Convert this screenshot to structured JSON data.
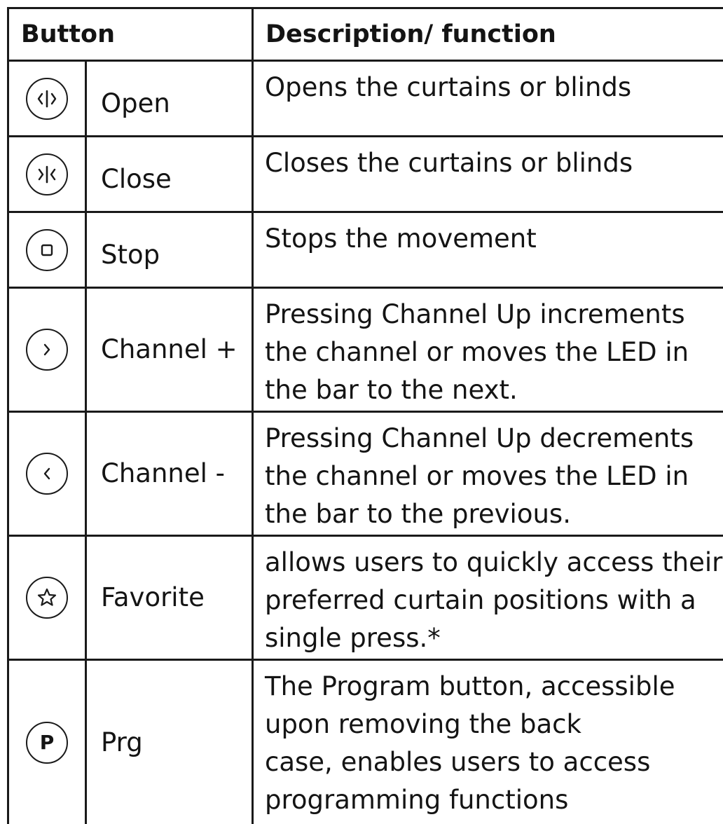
{
  "header": {
    "button": "Button",
    "description": "Description/ function"
  },
  "rows": [
    {
      "icon": "open-icon",
      "label": "Open",
      "description": [
        "Opens the curtains or blinds"
      ]
    },
    {
      "icon": "close-icon",
      "label": "Close",
      "description": [
        "Closes the curtains or blinds"
      ]
    },
    {
      "icon": "stop-icon",
      "label": "Stop",
      "description": [
        "Stops the movement"
      ]
    },
    {
      "icon": "chevron-right-icon",
      "label": "Channel +",
      "description": [
        "Pressing Channel Up increments",
        "the channel or moves the LED in",
        "the bar to the next."
      ]
    },
    {
      "icon": "chevron-left-icon",
      "label": "Channel -",
      "description": [
        "Pressing Channel Up decrements",
        "the channel or moves the LED in",
        "the bar to the previous."
      ]
    },
    {
      "icon": "star-icon",
      "label": "Favorite",
      "description": [
        "allows users to quickly access their",
        "preferred curtain positions with a",
        "single press.*"
      ]
    },
    {
      "icon": "program-icon",
      "icon_text": "P",
      "label": "Prg",
      "description": [
        "The Program button, accessible",
        "upon removing the back",
        "case, enables users to access",
        "programming functions"
      ]
    }
  ]
}
